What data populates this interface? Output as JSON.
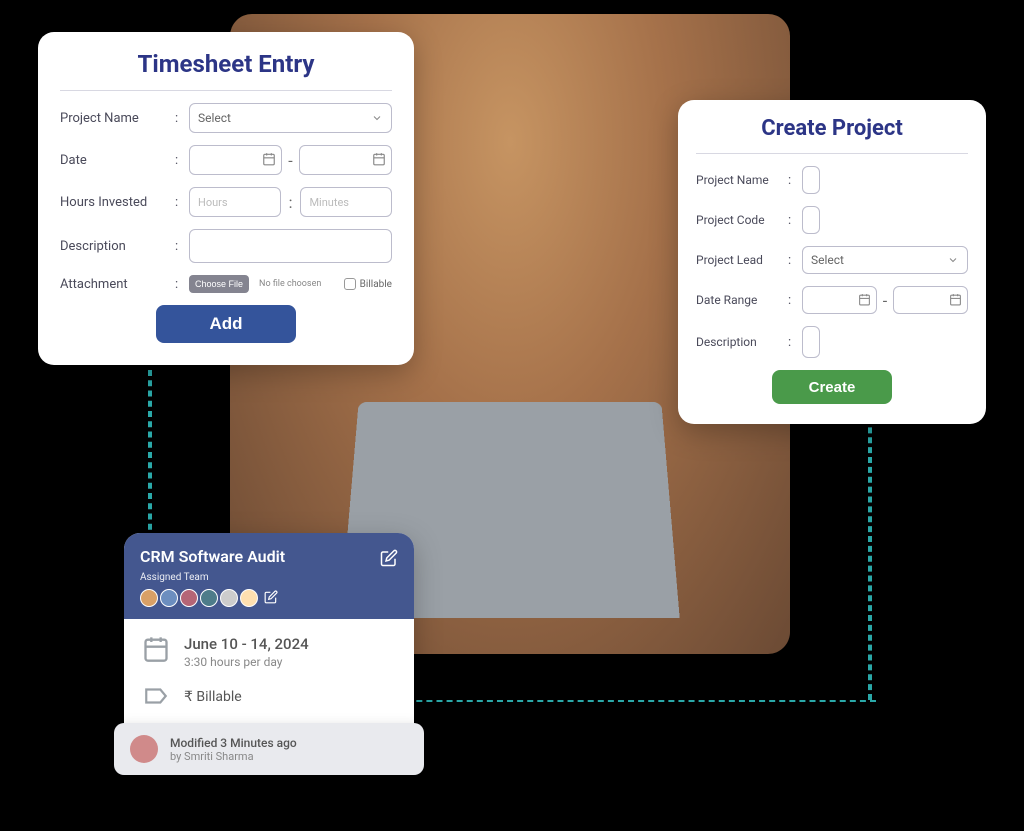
{
  "timesheet": {
    "title": "Timesheet Entry",
    "labels": {
      "project": "Project Name",
      "date": "Date",
      "hours": "Hours Invested",
      "description": "Description",
      "attachment": "Attachment"
    },
    "project_select_placeholder": "Select",
    "hours_placeholder": "Hours",
    "minutes_placeholder": "Minutes",
    "choose_file": "Choose File",
    "no_file": "No file choosen",
    "billable_label": "Billable",
    "add_button": "Add"
  },
  "create_project": {
    "title": "Create Project",
    "labels": {
      "name": "Project Name",
      "code": "Project Code",
      "lead": "Project Lead",
      "range": "Date Range",
      "description": "Description"
    },
    "lead_select_placeholder": "Select",
    "create_button": "Create"
  },
  "summary": {
    "title": "CRM Software Audit",
    "assigned_label": "Assigned Team",
    "date_range": "June 10 - 14, 2024",
    "hours_per_day": "3:30 hours per day",
    "billable_label": "Billable",
    "currency_symbol": "₹",
    "modified_text": "Modified 3 Minutes ago",
    "modified_by": "by Smriti Sharma"
  }
}
